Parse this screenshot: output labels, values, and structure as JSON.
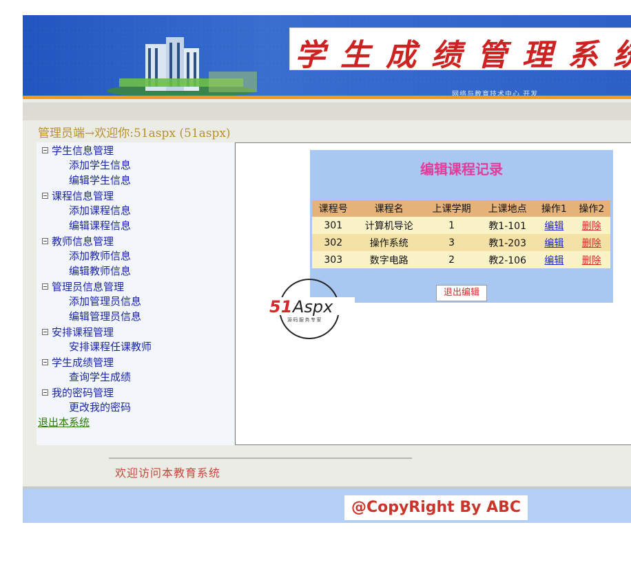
{
  "header": {
    "title": "学生成绩管理系统",
    "subtitle": "网络与教育技术中心 开发"
  },
  "welcome": {
    "text": "管理员端→欢迎你:51aspx (51aspx)"
  },
  "sidebar": {
    "groups": [
      {
        "label": "学生信息管理",
        "items": [
          "添加学生信息",
          "编辑学生信息"
        ]
      },
      {
        "label": "课程信息管理",
        "items": [
          "添加课程信息",
          "编辑课程信息"
        ]
      },
      {
        "label": "教师信息管理",
        "items": [
          "添加教师信息",
          "编辑教师信息"
        ]
      },
      {
        "label": "管理员信息管理",
        "items": [
          "添加管理员信息",
          "编辑管理员信息"
        ]
      },
      {
        "label": "安排课程管理",
        "items": [
          "安排课程任课教师"
        ]
      },
      {
        "label": "学生成绩管理",
        "items": [
          "查询学生成绩"
        ]
      },
      {
        "label": "我的密码管理",
        "items": [
          "更改我的密码"
        ]
      }
    ],
    "logout": "退出本系统"
  },
  "panel": {
    "title": "编辑课程记录",
    "columns": [
      "课程号",
      "课程名",
      "上课学期",
      "上课地点",
      "操作1",
      "操作2"
    ],
    "rows": [
      {
        "id": "301",
        "name": "计算机导论",
        "term": "1",
        "place": "教1-101",
        "op1": "编辑",
        "op2": "删除"
      },
      {
        "id": "302",
        "name": "操作系统",
        "term": "3",
        "place": "教1-203",
        "op1": "编辑",
        "op2": "删除"
      },
      {
        "id": "303",
        "name": "数字电路",
        "term": "2",
        "place": "教2-106",
        "op1": "编辑",
        "op2": "删除"
      }
    ],
    "exit_button": "退出编辑"
  },
  "logo": {
    "text": "51Aspx",
    "sub": "源码服务专家"
  },
  "footer": {
    "welcome": "欢迎访问本教育系统",
    "copyright": "@CopyRight By ABC"
  },
  "colors": {
    "banner": "#2f63c8",
    "accent": "#f29a1f",
    "panel": "#a8c8f2",
    "title_pink": "#e23c9a",
    "link_blue": "#1a24a8"
  }
}
